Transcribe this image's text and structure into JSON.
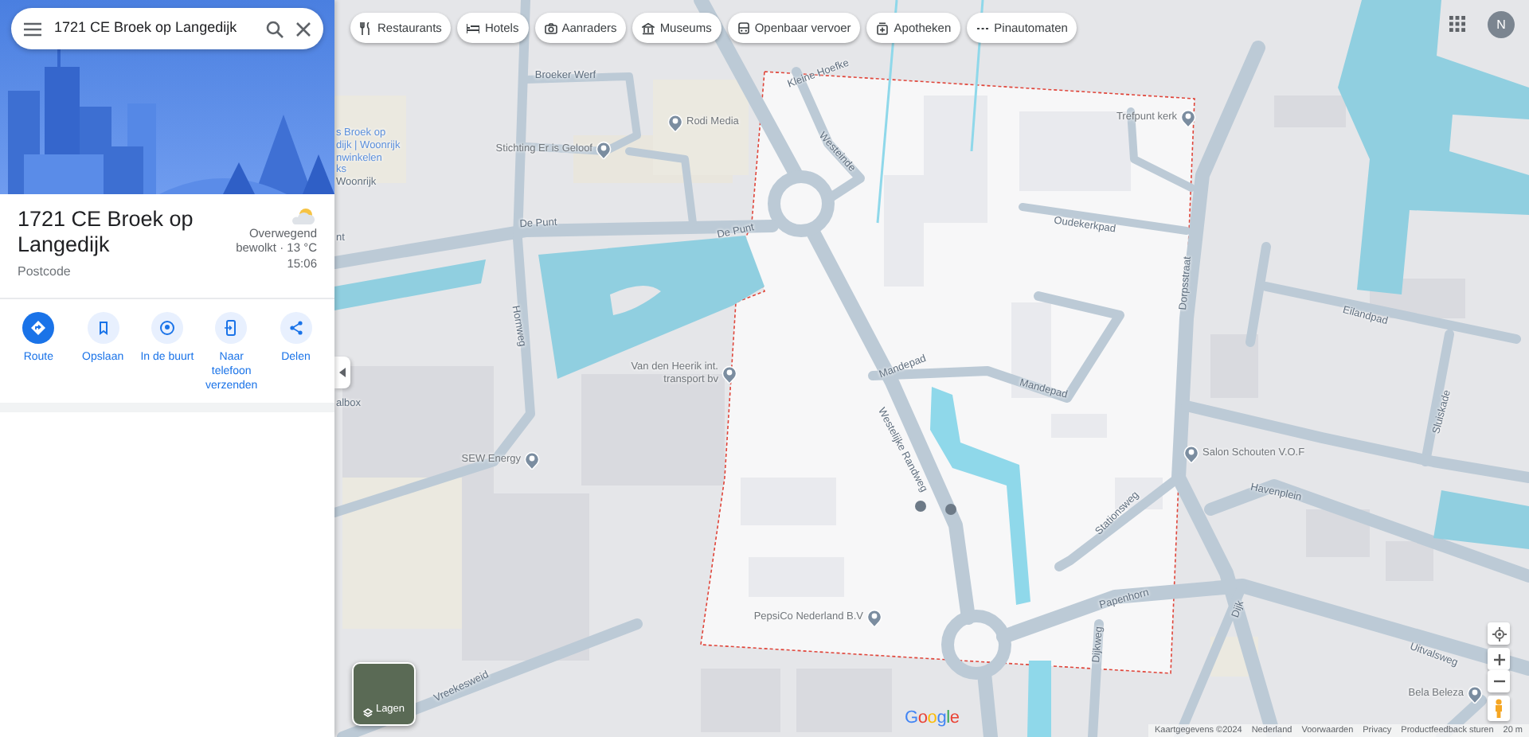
{
  "search": {
    "value": "1721 CE Broek op Langedijk"
  },
  "place": {
    "title": "1721 CE Broek op Langedijk",
    "subtitle": "Postcode",
    "weather": {
      "condition": "Overwegend bewolkt · 13 °C",
      "time": "15:06"
    }
  },
  "actions": [
    {
      "label": "Route",
      "kind": "route",
      "primary": true
    },
    {
      "label": "Opslaan",
      "kind": "save",
      "primary": false
    },
    {
      "label": "In de buurt",
      "kind": "nearby",
      "primary": false
    },
    {
      "label": "Naar telefoon verzenden",
      "kind": "phone",
      "primary": false
    },
    {
      "label": "Delen",
      "kind": "share",
      "primary": false
    }
  ],
  "categories": [
    {
      "label": "Restaurants",
      "kind": "restaurant"
    },
    {
      "label": "Hotels",
      "kind": "hotel"
    },
    {
      "label": "Aanraders",
      "kind": "camera"
    },
    {
      "label": "Museums",
      "kind": "museum"
    },
    {
      "label": "Openbaar vervoer",
      "kind": "transit"
    },
    {
      "label": "Apotheken",
      "kind": "pharmacy"
    },
    {
      "label": "Pinautomaten",
      "kind": "atm"
    }
  ],
  "account": {
    "initial": "N"
  },
  "map": {
    "labels": [
      {
        "text": "s Broek op",
        "kind": "area"
      },
      {
        "text": "dijk | Woonrijk",
        "kind": "area"
      },
      {
        "text": "nwinkelen",
        "kind": "area"
      },
      {
        "text": "ks",
        "kind": "area"
      },
      {
        "text": "Woonrijk",
        "kind": "street"
      },
      {
        "text": "nt",
        "kind": "street"
      },
      {
        "text": "albox",
        "kind": "street"
      },
      {
        "text": "Broeker Werf",
        "kind": "street"
      },
      {
        "text": "Rodi Media",
        "kind": "place"
      },
      {
        "text": "Stichting Er is Geloof",
        "kind": "place"
      },
      {
        "text": "De Punt",
        "kind": "street"
      },
      {
        "text": "De Punt",
        "kind": "street"
      },
      {
        "text": "Hornweg",
        "kind": "street"
      },
      {
        "text": "Van den Heerik int. transport bv",
        "kind": "place"
      },
      {
        "text": "SEW Energy",
        "kind": "place"
      },
      {
        "text": "Kleine Hoefke",
        "kind": "street"
      },
      {
        "text": "Westeinde",
        "kind": "street"
      },
      {
        "text": "Trefpunt kerk",
        "kind": "place"
      },
      {
        "text": "Oudekerkpad",
        "kind": "street"
      },
      {
        "text": "Dorpsstraat",
        "kind": "street"
      },
      {
        "text": "Eilandpad",
        "kind": "street"
      },
      {
        "text": "Mandepad",
        "kind": "street"
      },
      {
        "text": "Mandepad",
        "kind": "street"
      },
      {
        "text": "Westelijke Randweg",
        "kind": "street"
      },
      {
        "text": "Sluiskade",
        "kind": "street"
      },
      {
        "text": "Salon Schouten V.O.F",
        "kind": "place"
      },
      {
        "text": "Havenplein",
        "kind": "street"
      },
      {
        "text": "Stationsweg",
        "kind": "street"
      },
      {
        "text": "Papenhorn",
        "kind": "street"
      },
      {
        "text": "Dijkweg",
        "kind": "street"
      },
      {
        "text": "Dijk",
        "kind": "street"
      },
      {
        "text": "Uitvalsweg",
        "kind": "street"
      },
      {
        "text": "Bela Beleza",
        "kind": "place"
      },
      {
        "text": "PepsiCo Nederland B.V",
        "kind": "place"
      },
      {
        "text": "Vreekesweid",
        "kind": "street"
      }
    ],
    "layers_button": {
      "label": "Lagen"
    },
    "logo": "Google",
    "attribution": [
      "Kaartgegevens ©2024",
      "Nederland",
      "Voorwaarden",
      "Privacy",
      "Productfeedback sturen",
      "20 m"
    ]
  }
}
